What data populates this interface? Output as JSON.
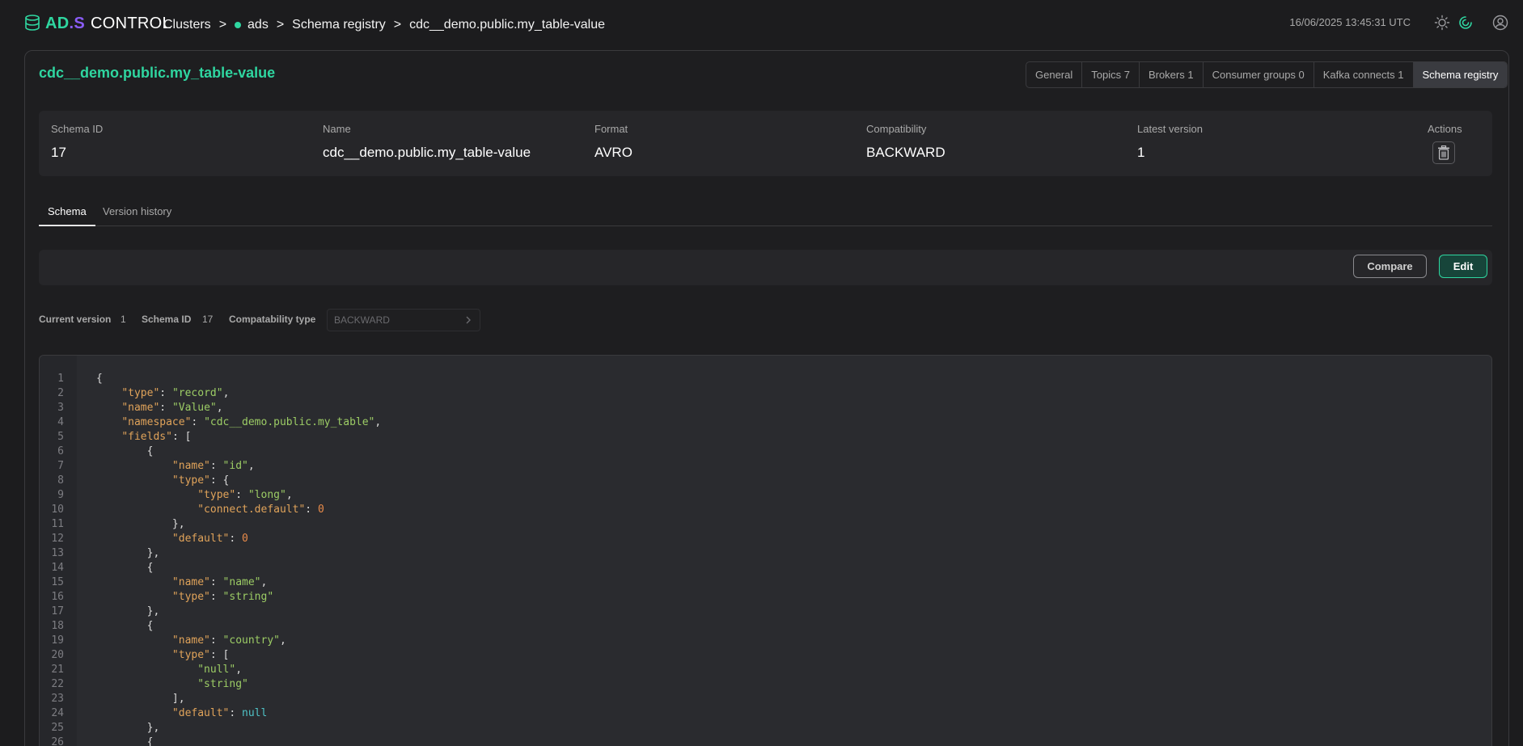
{
  "header": {
    "logo": {
      "ad": "AD",
      "dot": ".",
      "s": "S",
      "control": "CONTROL"
    },
    "breadcrumb": {
      "clusters": "Clusters",
      "sep": ">",
      "cluster": "ads",
      "section": "Schema registry",
      "current": "cdc__demo.public.my_table-value"
    },
    "datetime": "16/06/2025  13:45:31  UTC",
    "icons": [
      "sun-icon",
      "refresh-icon",
      "user-icon"
    ]
  },
  "page": {
    "title": "cdc__demo.public.my_table-value",
    "nav_tabs": [
      {
        "label": "General",
        "active": false
      },
      {
        "label": "Topics 7",
        "active": false
      },
      {
        "label": "Brokers 1",
        "active": false
      },
      {
        "label": "Consumer groups 0",
        "active": false
      },
      {
        "label": "Kafka connects 1",
        "active": false
      },
      {
        "label": "Schema registry",
        "active": true
      }
    ]
  },
  "info": {
    "schema_id": {
      "label": "Schema ID",
      "value": "17"
    },
    "name": {
      "label": "Name",
      "value": "cdc__demo.public.my_table-value"
    },
    "format": {
      "label": "Format",
      "value": "AVRO"
    },
    "compatibility": {
      "label": "Compatibility",
      "value": "BACKWARD"
    },
    "latest_version": {
      "label": "Latest version",
      "value": "1"
    },
    "actions": {
      "label": "Actions"
    }
  },
  "subtabs": [
    {
      "label": "Schema",
      "active": true
    },
    {
      "label": "Version history",
      "active": false
    }
  ],
  "toolbar": {
    "compare_label": "Compare",
    "edit_label": "Edit"
  },
  "version_row": {
    "current_version_label": "Current version",
    "current_version": "1",
    "schema_id_label": "Schema ID",
    "schema_id": "17",
    "compat_type_label": "Compatability type",
    "compat_type_placeholder": "BACKWARD"
  },
  "code": [
    [
      [
        "p",
        "{"
      ]
    ],
    [
      [
        "p",
        "    "
      ],
      [
        "k",
        "\"type\""
      ],
      [
        "p",
        ": "
      ],
      [
        "s",
        "\"record\""
      ],
      [
        "p",
        ","
      ]
    ],
    [
      [
        "p",
        "    "
      ],
      [
        "k",
        "\"name\""
      ],
      [
        "p",
        ": "
      ],
      [
        "s",
        "\"Value\""
      ],
      [
        "p",
        ","
      ]
    ],
    [
      [
        "p",
        "    "
      ],
      [
        "k",
        "\"namespace\""
      ],
      [
        "p",
        ": "
      ],
      [
        "s",
        "\"cdc__demo.public.my_table\""
      ],
      [
        "p",
        ","
      ]
    ],
    [
      [
        "p",
        "    "
      ],
      [
        "k",
        "\"fields\""
      ],
      [
        "p",
        ": ["
      ]
    ],
    [
      [
        "p",
        "        {"
      ]
    ],
    [
      [
        "p",
        "            "
      ],
      [
        "k",
        "\"name\""
      ],
      [
        "p",
        ": "
      ],
      [
        "s",
        "\"id\""
      ],
      [
        "p",
        ","
      ]
    ],
    [
      [
        "p",
        "            "
      ],
      [
        "k",
        "\"type\""
      ],
      [
        "p",
        ": {"
      ]
    ],
    [
      [
        "p",
        "                "
      ],
      [
        "k",
        "\"type\""
      ],
      [
        "p",
        ": "
      ],
      [
        "s",
        "\"long\""
      ],
      [
        "p",
        ","
      ]
    ],
    [
      [
        "p",
        "                "
      ],
      [
        "k",
        "\"connect.default\""
      ],
      [
        "p",
        ": "
      ],
      [
        "n",
        "0"
      ]
    ],
    [
      [
        "p",
        "            },"
      ]
    ],
    [
      [
        "p",
        "            "
      ],
      [
        "k",
        "\"default\""
      ],
      [
        "p",
        ": "
      ],
      [
        "n",
        "0"
      ]
    ],
    [
      [
        "p",
        "        },"
      ]
    ],
    [
      [
        "p",
        "        {"
      ]
    ],
    [
      [
        "p",
        "            "
      ],
      [
        "k",
        "\"name\""
      ],
      [
        "p",
        ": "
      ],
      [
        "s",
        "\"name\""
      ],
      [
        "p",
        ","
      ]
    ],
    [
      [
        "p",
        "            "
      ],
      [
        "k",
        "\"type\""
      ],
      [
        "p",
        ": "
      ],
      [
        "s",
        "\"string\""
      ]
    ],
    [
      [
        "p",
        "        },"
      ]
    ],
    [
      [
        "p",
        "        {"
      ]
    ],
    [
      [
        "p",
        "            "
      ],
      [
        "k",
        "\"name\""
      ],
      [
        "p",
        ": "
      ],
      [
        "s",
        "\"country\""
      ],
      [
        "p",
        ","
      ]
    ],
    [
      [
        "p",
        "            "
      ],
      [
        "k",
        "\"type\""
      ],
      [
        "p",
        ": ["
      ]
    ],
    [
      [
        "p",
        "                "
      ],
      [
        "s",
        "\"null\""
      ],
      [
        "p",
        ","
      ]
    ],
    [
      [
        "p",
        "                "
      ],
      [
        "s",
        "\"string\""
      ]
    ],
    [
      [
        "p",
        "            ],"
      ]
    ],
    [
      [
        "p",
        "            "
      ],
      [
        "k",
        "\"default\""
      ],
      [
        "p",
        ": "
      ],
      [
        "nl",
        "null"
      ]
    ],
    [
      [
        "p",
        "        },"
      ]
    ],
    [
      [
        "p",
        "        {"
      ]
    ]
  ]
}
